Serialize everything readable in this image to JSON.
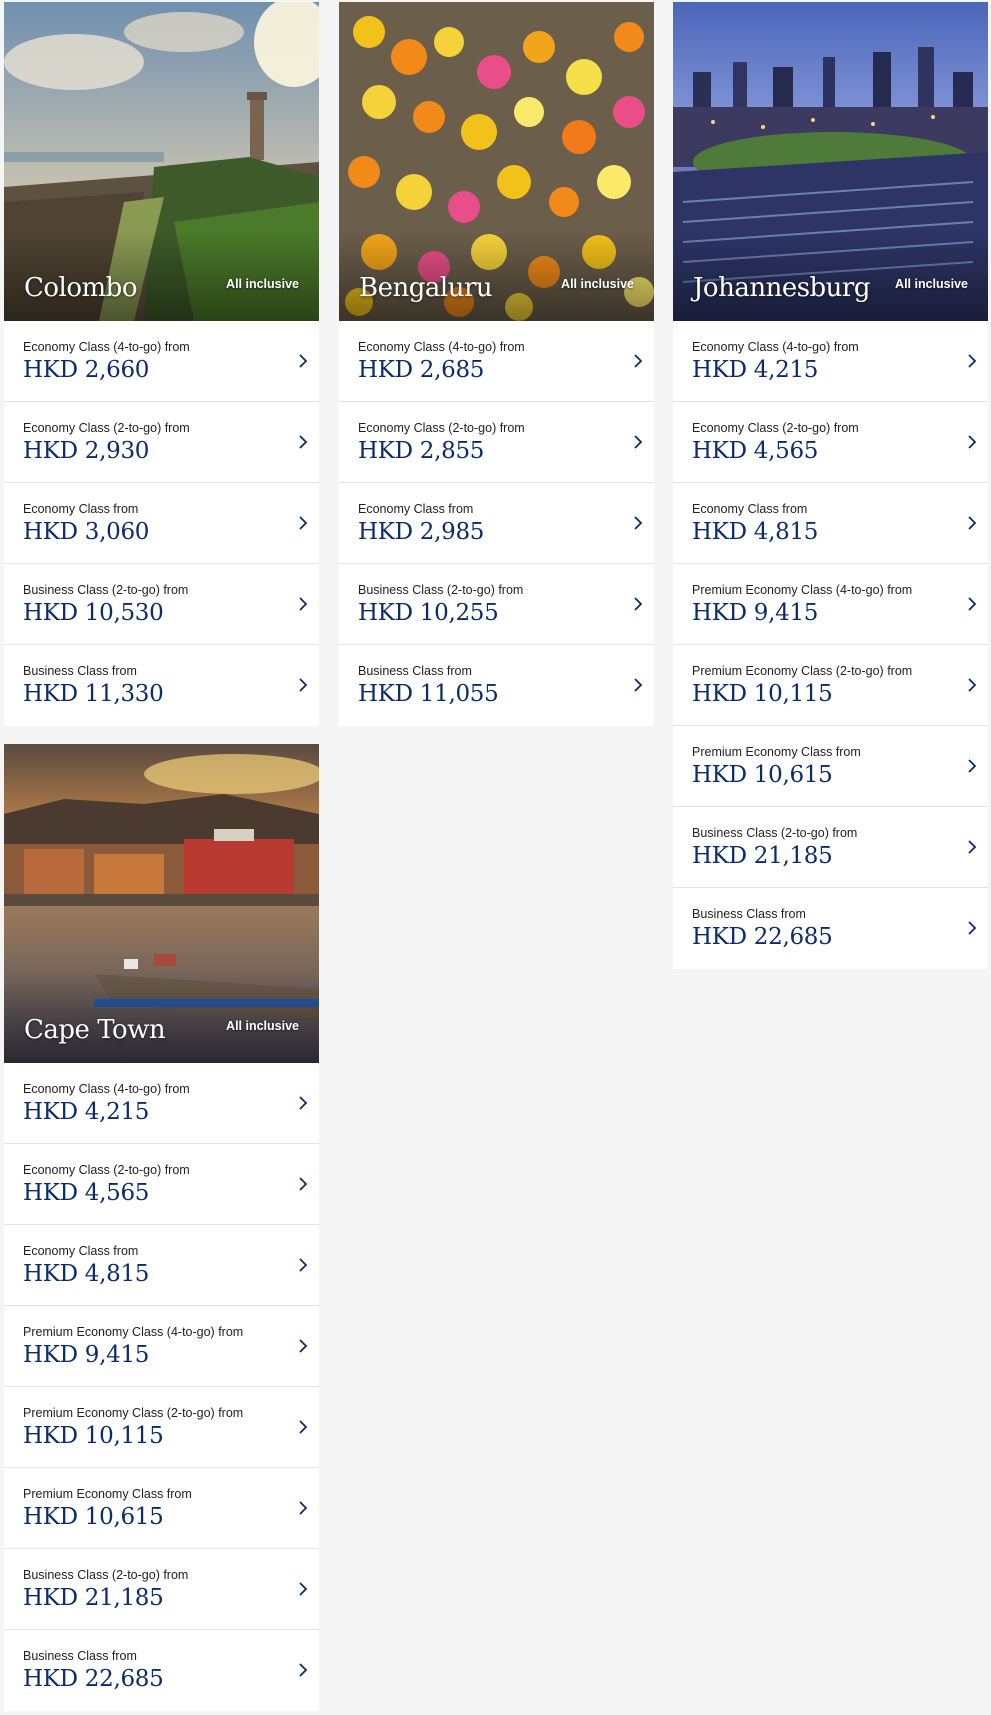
{
  "colors": {
    "price": "#0b2c6b",
    "chevron": "#0b2c6b",
    "background": "#f5f5f5"
  },
  "destinations": [
    {
      "city": "Colombo",
      "badge": "All inclusive",
      "fares": [
        {
          "label": "Economy Class (4-to-go) from",
          "price": "HKD 2,660"
        },
        {
          "label": "Economy Class (2-to-go) from",
          "price": "HKD 2,930"
        },
        {
          "label": "Economy Class from",
          "price": "HKD 3,060"
        },
        {
          "label": "Business Class (2-to-go) from",
          "price": "HKD 10,530"
        },
        {
          "label": "Business Class from",
          "price": "HKD 11,330"
        }
      ]
    },
    {
      "city": "Bengaluru",
      "badge": "All inclusive",
      "fares": [
        {
          "label": "Economy Class (4-to-go) from",
          "price": "HKD 2,685"
        },
        {
          "label": "Economy Class (2-to-go) from",
          "price": "HKD 2,855"
        },
        {
          "label": "Economy Class from",
          "price": "HKD 2,985"
        },
        {
          "label": "Business Class (2-to-go) from",
          "price": "HKD 10,255"
        },
        {
          "label": "Business Class from",
          "price": "HKD 11,055"
        }
      ]
    },
    {
      "city": "Johannesburg",
      "badge": "All inclusive",
      "fares": [
        {
          "label": "Economy Class (4-to-go) from",
          "price": "HKD 4,215"
        },
        {
          "label": "Economy Class (2-to-go) from",
          "price": "HKD 4,565"
        },
        {
          "label": "Economy Class from",
          "price": "HKD 4,815"
        },
        {
          "label": "Premium Economy Class (4-to-go) from",
          "price": "HKD 9,415"
        },
        {
          "label": "Premium Economy Class (2-to-go) from",
          "price": "HKD 10,115"
        },
        {
          "label": "Premium Economy Class from",
          "price": "HKD 10,615"
        },
        {
          "label": "Business Class (2-to-go) from",
          "price": "HKD 21,185"
        },
        {
          "label": "Business Class from",
          "price": "HKD 22,685"
        }
      ]
    },
    {
      "city": "Cape Town",
      "badge": "All inclusive",
      "fares": [
        {
          "label": "Economy Class (4-to-go) from",
          "price": "HKD 4,215"
        },
        {
          "label": "Economy Class (2-to-go) from",
          "price": "HKD 4,565"
        },
        {
          "label": "Economy Class from",
          "price": "HKD 4,815"
        },
        {
          "label": "Premium Economy Class (4-to-go) from",
          "price": "HKD 9,415"
        },
        {
          "label": "Premium Economy Class (2-to-go) from",
          "price": "HKD 10,115"
        },
        {
          "label": "Premium Economy Class from",
          "price": "HKD 10,615"
        },
        {
          "label": "Business Class (2-to-go) from",
          "price": "HKD 21,185"
        },
        {
          "label": "Business Class from",
          "price": "HKD 22,685"
        }
      ]
    }
  ]
}
